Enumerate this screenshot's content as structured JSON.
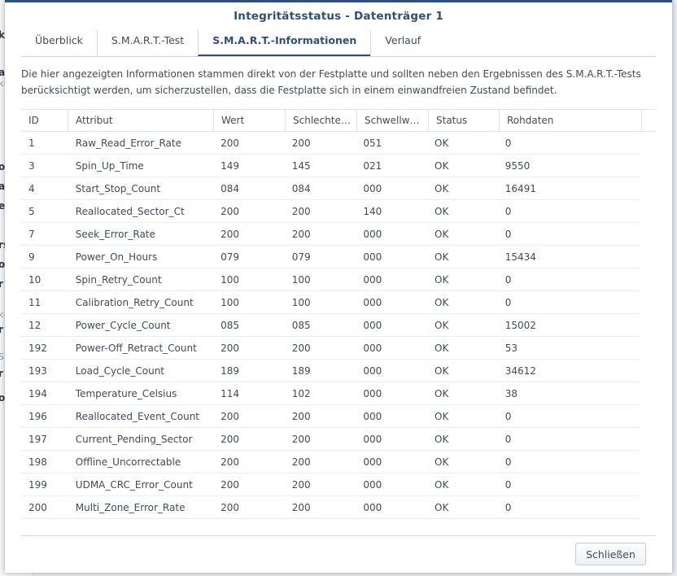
{
  "background_fragments": [
    "k",
    "k-",
    "a",
    "o",
    "a",
    "e",
    "rs",
    "o",
    "r",
    "k-",
    "r",
    "S",
    "r",
    "o"
  ],
  "dialog": {
    "title": "Integritätsstatus - Datenträger 1",
    "tabs": [
      {
        "label": "Überblick",
        "active": false
      },
      {
        "label": "S.M.A.R.T.-Test",
        "active": false
      },
      {
        "label": "S.M.A.R.T.-Informationen",
        "active": true
      },
      {
        "label": "Verlauf",
        "active": false
      }
    ],
    "intro": "Die hier angezeigten Informationen stammen direkt von der Festplatte und sollten neben den Ergebnissen des S.M.A.R.T.-Tests berücksichtigt werden, um sicherzustellen, dass die Festplatte sich in einem einwandfreien Zustand befindet.",
    "columns": [
      "ID",
      "Attribut",
      "Wert",
      "Schlechte…",
      "Schwellw…",
      "Status",
      "Rohdaten"
    ],
    "rows": [
      {
        "id": "1",
        "attr": "Raw_Read_Error_Rate",
        "value": "200",
        "worst": "200",
        "threshold": "051",
        "status": "OK",
        "raw": "0"
      },
      {
        "id": "3",
        "attr": "Spin_Up_Time",
        "value": "149",
        "worst": "145",
        "threshold": "021",
        "status": "OK",
        "raw": "9550"
      },
      {
        "id": "4",
        "attr": "Start_Stop_Count",
        "value": "084",
        "worst": "084",
        "threshold": "000",
        "status": "OK",
        "raw": "16491"
      },
      {
        "id": "5",
        "attr": "Reallocated_Sector_Ct",
        "value": "200",
        "worst": "200",
        "threshold": "140",
        "status": "OK",
        "raw": "0"
      },
      {
        "id": "7",
        "attr": "Seek_Error_Rate",
        "value": "200",
        "worst": "200",
        "threshold": "000",
        "status": "OK",
        "raw": "0"
      },
      {
        "id": "9",
        "attr": "Power_On_Hours",
        "value": "079",
        "worst": "079",
        "threshold": "000",
        "status": "OK",
        "raw": "15434"
      },
      {
        "id": "10",
        "attr": "Spin_Retry_Count",
        "value": "100",
        "worst": "100",
        "threshold": "000",
        "status": "OK",
        "raw": "0"
      },
      {
        "id": "11",
        "attr": "Calibration_Retry_Count",
        "value": "100",
        "worst": "100",
        "threshold": "000",
        "status": "OK",
        "raw": "0"
      },
      {
        "id": "12",
        "attr": "Power_Cycle_Count",
        "value": "085",
        "worst": "085",
        "threshold": "000",
        "status": "OK",
        "raw": "15002"
      },
      {
        "id": "192",
        "attr": "Power-Off_Retract_Count",
        "value": "200",
        "worst": "200",
        "threshold": "000",
        "status": "OK",
        "raw": "53"
      },
      {
        "id": "193",
        "attr": "Load_Cycle_Count",
        "value": "189",
        "worst": "189",
        "threshold": "000",
        "status": "OK",
        "raw": "34612"
      },
      {
        "id": "194",
        "attr": "Temperature_Celsius",
        "value": "114",
        "worst": "102",
        "threshold": "000",
        "status": "OK",
        "raw": "38"
      },
      {
        "id": "196",
        "attr": "Reallocated_Event_Count",
        "value": "200",
        "worst": "200",
        "threshold": "000",
        "status": "OK",
        "raw": "0"
      },
      {
        "id": "197",
        "attr": "Current_Pending_Sector",
        "value": "200",
        "worst": "200",
        "threshold": "000",
        "status": "OK",
        "raw": "0"
      },
      {
        "id": "198",
        "attr": "Offline_Uncorrectable",
        "value": "200",
        "worst": "200",
        "threshold": "000",
        "status": "OK",
        "raw": "0"
      },
      {
        "id": "199",
        "attr": "UDMA_CRC_Error_Count",
        "value": "200",
        "worst": "200",
        "threshold": "000",
        "status": "OK",
        "raw": "0"
      },
      {
        "id": "200",
        "attr": "Multi_Zone_Error_Rate",
        "value": "200",
        "worst": "200",
        "threshold": "000",
        "status": "OK",
        "raw": "0"
      }
    ],
    "close_label": "Schließen"
  },
  "colors": {
    "accent": "#2f4f7a",
    "title_bar": "#2b4f7e"
  }
}
